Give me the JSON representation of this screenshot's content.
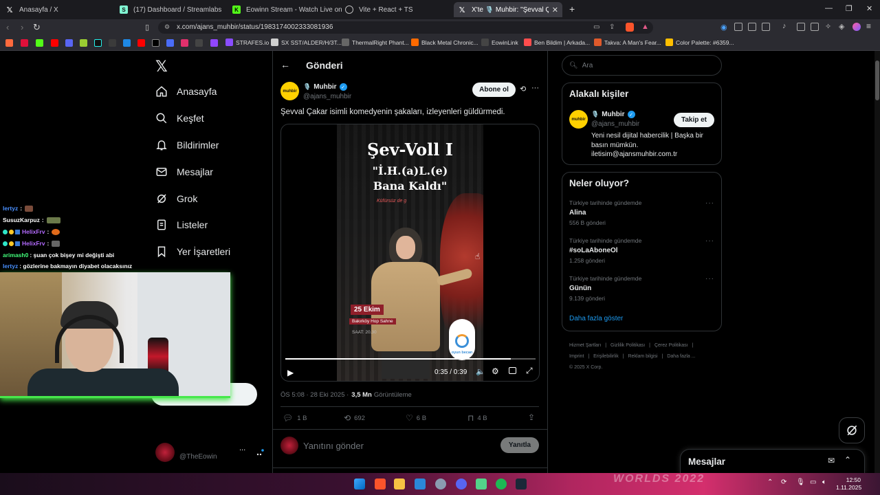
{
  "browser": {
    "tabs": [
      {
        "label": "Anasayfa / X",
        "icon": "x-icon",
        "active": false
      },
      {
        "label": "(17) Dashboard / Streamlabs",
        "icon": "streamlabs-icon",
        "active": false
      },
      {
        "label": "Eowinn Stream - Watch Live on Kick",
        "icon": "kick-icon",
        "active": false
      },
      {
        "label": "Vite + React + TS",
        "icon": "globe-icon",
        "active": false
      },
      {
        "label": "X'te 🎙️ Muhbir: \"Şevval Çakar is...",
        "icon": "x-icon",
        "active": true
      }
    ],
    "new_tab": "+",
    "url": "x.com/ajans_muhbir/status/1983174002333081936",
    "bookmarks": [
      {
        "label": "STRAFES.io",
        "color": "#8a4dff"
      },
      {
        "label": "SX SST/ALDER/H/3T...",
        "color": "#cfcfcf"
      },
      {
        "label": "ThermalRight Phant...",
        "color": "#3a3a3a"
      },
      {
        "label": "Black Metal Chronic...",
        "color": "#ff6a00"
      },
      {
        "label": "EowinLink",
        "color": "#1e1e1e"
      },
      {
        "label": "Ben Bildim | Arkada...",
        "color": "#ff4d4d"
      },
      {
        "label": "Takva: A Man's Fear...",
        "color": "#e05a2b"
      },
      {
        "label": "Color Palette: #6359...",
        "color": "#ffbf00"
      }
    ]
  },
  "sidebar": {
    "logo": "X",
    "items": [
      {
        "label": "Anasayfa",
        "icon": "home-icon"
      },
      {
        "label": "Keşfet",
        "icon": "search-icon"
      },
      {
        "label": "Bildirimler",
        "icon": "bell-icon"
      },
      {
        "label": "Mesajlar",
        "icon": "mail-icon"
      },
      {
        "label": "Grok",
        "icon": "grok-icon"
      },
      {
        "label": "Listeler",
        "icon": "list-icon"
      },
      {
        "label": "Yer İşaretleri",
        "icon": "bookmark-icon"
      }
    ],
    "account_handle": "@TheEowin",
    "more": "..."
  },
  "chat": [
    {
      "user": "lertyz",
      "text": ":",
      "color": "#4a90ff"
    },
    {
      "user": "SusuzKarpuz",
      "text": ":",
      "color": "#ffffff"
    },
    {
      "user": "HelixFrv",
      "text": ":",
      "color": "#b46bff"
    },
    {
      "user": "HelixFrv",
      "text": ":",
      "color": "#b46bff"
    },
    {
      "user": "arimash0",
      "text": ": şuan çok bişey mi değişti abi",
      "color": "#42ff7b"
    },
    {
      "user": "lertyz",
      "text": ": gözlerine bakmayın diyabet olacaksınız",
      "color": "#4a90ff"
    }
  ],
  "post_header": {
    "back": "←",
    "title": "Gönderi"
  },
  "tweet": {
    "author_name": "Muhbir",
    "author_handle": "@ajans_muhbir",
    "avatar_text": "muhbir",
    "subscribe_label": "Abone ol",
    "text": "Şevval Çakar isimli komedyenin şakaları, izleyenleri güldürmedi.",
    "video": {
      "poster_title_1": "Şev-Voll I",
      "poster_title_2": "\"İ.H.(a)L.(e)",
      "poster_title_3": "Bana Kaldı\"",
      "poster_sub": "Küfürsüz de g",
      "poster_date": "25 Ekim",
      "poster_venue": "Bakırköy Hop Sahne",
      "poster_time": "SAAT: 20.30",
      "badge": "oyun becan",
      "time": "0:35 / 0:39",
      "progress": 0.9
    },
    "timestamp": "ÖS 5:08 · 28 Eki 2025 ·",
    "views_count": "3,5 Mn",
    "views_label": "Görüntüleme",
    "stats": {
      "replies": "1 B",
      "reposts": "692",
      "likes": "6 B",
      "bookmarks": "4 B"
    },
    "reply_placeholder": "Yanıtını gönder",
    "reply_button": "Yanıtla"
  },
  "right": {
    "search_placeholder": "Ara",
    "relevant_title": "Alakalı kişiler",
    "relevant": {
      "name": "Muhbir",
      "handle": "@ajans_muhbir",
      "bio_1": "Yeni nesil dijital habercilik | Başka bir",
      "bio_2": "basın mümkün.",
      "bio_3": "iletisim@ajansmuhbir.com.tr",
      "follow_label": "Takip et"
    },
    "trends_title": "Neler oluyor?",
    "trends": [
      {
        "meta": "Türkiye tarihinde gündemde",
        "title": "Alina",
        "count": "556 B gönderi"
      },
      {
        "meta": "Türkiye tarihinde gündemde",
        "title": "#soLaAboneOl",
        "count": "1.258 gönderi"
      },
      {
        "meta": "Türkiye tarihinde gündemde",
        "title": "Günün",
        "count": "9.139 gönderi"
      }
    ],
    "show_more": "Daha fazla göster",
    "footer": [
      "Hizmet Şartları",
      "Gizlilik Politikası",
      "Çerez Politikası",
      "Imprint",
      "Erişilebilirlik",
      "Reklam bilgisi",
      "Daha fazla ...",
      "© 2025 X Corp."
    ]
  },
  "messages_dock": {
    "label": "Mesajlar"
  },
  "taskbar": {
    "time": "12:50",
    "date": "1.11.2025",
    "wallpaper_text": "WORLDS 2022"
  },
  "colors": {
    "accent": "#1d9bf0",
    "verified": "#1d9bf0",
    "bg": "#000000",
    "border": "#2f3336"
  }
}
